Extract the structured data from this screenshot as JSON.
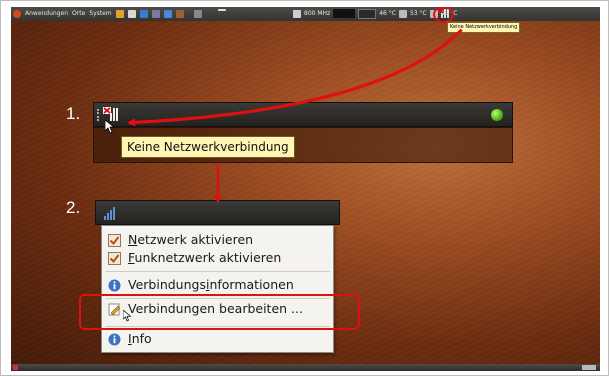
{
  "top_panel": {
    "menus": [
      "Anwendungen",
      "Orte",
      "System"
    ],
    "tray_speed": "800 MHz",
    "temp1": "46 °C",
    "temp2": "53 °C",
    "temp3": "46 °C"
  },
  "tray_tooltip": "Keine Netzwerkverbindung",
  "steps": {
    "one": "1.",
    "two": "2."
  },
  "panel1": {
    "tooltip": "Keine Netzwerkverbindung"
  },
  "menu": {
    "enable_network": {
      "before": "",
      "mnemonic": "N",
      "after": "etzwerk aktivieren"
    },
    "enable_wireless": {
      "before": "",
      "mnemonic": "F",
      "after": "unknetzwerk aktivieren"
    },
    "connection_info": {
      "before": "Verbindungs",
      "mnemonic": "i",
      "after": "nformationen"
    },
    "edit_connections": {
      "before": "Verbindungen bearbeiten ...",
      "mnemonic": "",
      "after": ""
    },
    "info": {
      "before": "",
      "mnemonic": "I",
      "after": "nfo"
    }
  },
  "colors": {
    "highlight_red": "#e01010",
    "indicator_green": "#4ab515"
  },
  "icons": [
    "network-disconnected-icon",
    "mouse-cursor-icon",
    "checkbox-icon",
    "info-icon",
    "edit-icon",
    "wireless-bars-icon",
    "indicator-icon"
  ]
}
